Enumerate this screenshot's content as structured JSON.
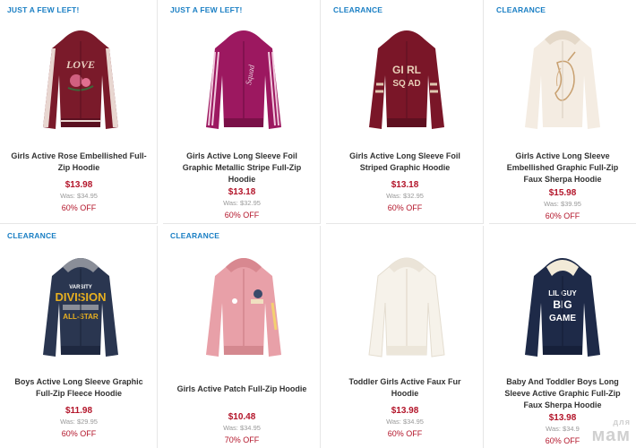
{
  "colors": {
    "few_left_badge": "#1a7fc4",
    "clearance_badge": "#1a7fc4",
    "price": "#b3152a",
    "percent_off": "#b3152a",
    "was": "#999999"
  },
  "products": [
    {
      "badge": "JUST A FEW LEFT!",
      "image": "maroon-rose-hoodie",
      "name": "Girls Active Rose Embellished Full-Zip Hoodie",
      "price": "$13.98",
      "was": "Was: $34.95",
      "off": "60% OFF"
    },
    {
      "badge": "JUST A FEW LEFT!",
      "image": "magenta-stripe-hoodie",
      "name": "Girls Active Long Sleeve Foil Graphic Metallic Stripe Full-Zip Hoodie",
      "price": "$13.18",
      "was": "Was: $32.95",
      "off": "60% OFF"
    },
    {
      "badge": "CLEARANCE",
      "image": "maroon-girl-squad-hoodie",
      "name": "Girls Active Long Sleeve Foil Striped Graphic Hoodie",
      "price": "$13.18",
      "was": "Was: $32.95",
      "off": "60% OFF"
    },
    {
      "badge": "CLEARANCE",
      "image": "cream-unicorn-hoodie",
      "name": "Girls Active Long Sleeve Embellished Graphic Full-Zip Faux Sherpa Hoodie",
      "price": "$15.98",
      "was": "Was: $39.95",
      "off": "60% OFF"
    },
    {
      "badge": "CLEARANCE",
      "image": "navy-division-hoodie",
      "name": "Boys Active Long Sleeve Graphic Full-Zip Fleece Hoodie",
      "price": "$11.98",
      "was": "Was: $29.95",
      "off": "60% OFF"
    },
    {
      "badge": "CLEARANCE",
      "image": "pink-patch-hoodie",
      "name": "Girls Active Patch Full-Zip Hoodie",
      "price": "$10.48",
      "was": "Was: $34.95",
      "off": "70% OFF"
    },
    {
      "badge": "",
      "image": "white-faux-fur-hoodie",
      "name": "Toddler Girls Active Faux Fur Hoodie",
      "price": "$13.98",
      "was": "Was: $34.95",
      "off": "60% OFF"
    },
    {
      "badge": "",
      "image": "navy-big-game-hoodie",
      "name": "Baby And Toddler Boys Long Sleeve Active Graphic Full-Zip Faux Sherpa Hoodie",
      "price": "$13.98",
      "was": "Was: $34.9",
      "off": "60% OFF"
    }
  ],
  "watermark": {
    "small": "для",
    "big": "мам"
  }
}
